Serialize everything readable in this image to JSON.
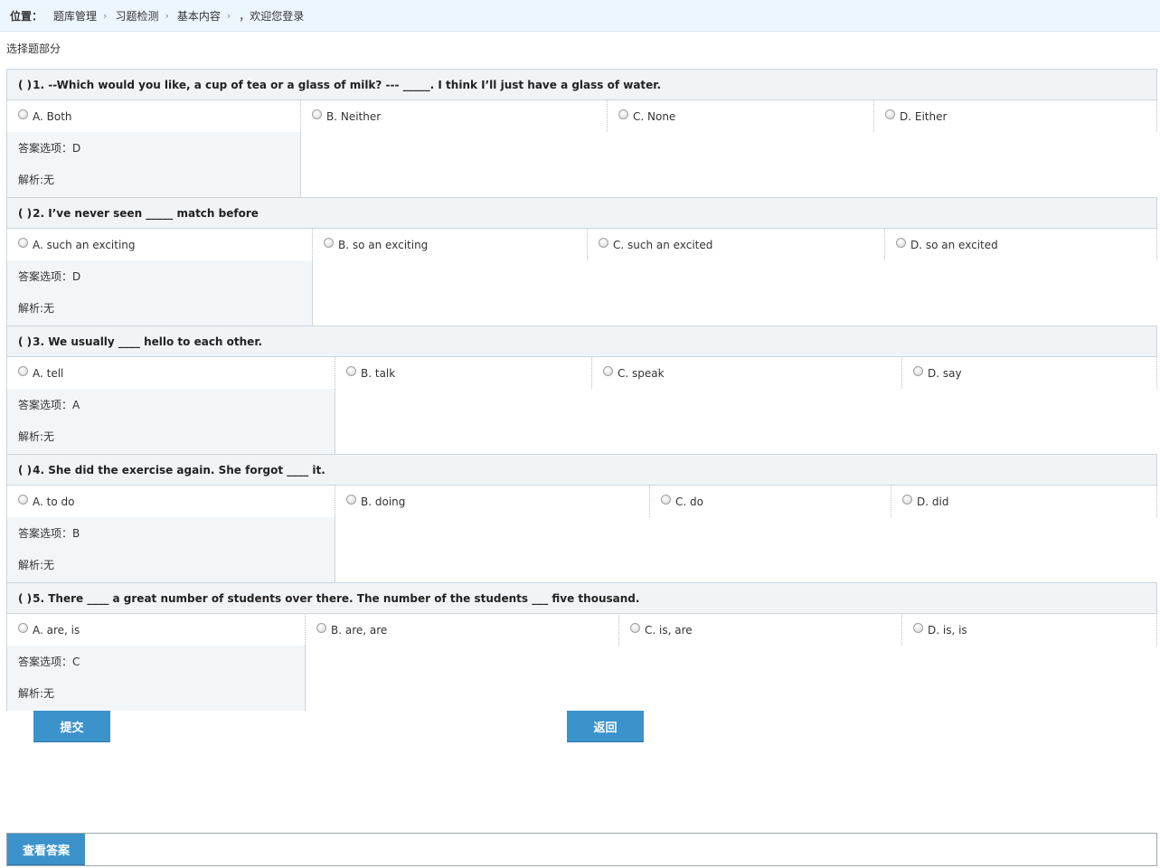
{
  "breadcrumb": {
    "label": "位置：",
    "items": [
      "题库管理",
      "习题检测",
      "基本内容"
    ],
    "welcome": "，欢迎您登录"
  },
  "section_title": "选择题部分",
  "questions": [
    {
      "title": "1. --Which would you like, a cup of tea or a glass of milk? --- _____. I think I’ll just have a glass of water.",
      "options": [
        "A. Both",
        "B. Neither",
        "C. None",
        "D. Either"
      ],
      "answer": "答案选项：D",
      "analysis": "解析:无"
    },
    {
      "title": "2. I’ve never seen _____ match before",
      "options": [
        "A. such an exciting",
        "B. so an exciting",
        "C. such an excited",
        "D. so an excited"
      ],
      "answer": "答案选项：D",
      "analysis": "解析:无"
    },
    {
      "title": "3. We usually ____ hello to each other.",
      "options": [
        "A. tell",
        "B. talk",
        "C. speak",
        "D. say"
      ],
      "answer": "答案选项：A",
      "analysis": "解析:无"
    },
    {
      "title": "4. She did the exercise again. She forgot ____ it.",
      "options": [
        "A. to do",
        "B. doing",
        "C. do",
        "D. did"
      ],
      "answer": "答案选项：B",
      "analysis": "解析:无"
    },
    {
      "title": "5. There ____ a great number of students over there. The number of the students ___ five thousand.",
      "options": [
        "A. are, is",
        "B. are, are",
        "C. is, are",
        "D. is, is"
      ],
      "answer": "答案选项：C",
      "analysis": "解析:无"
    }
  ],
  "buttons": {
    "submit": "提交",
    "back": "返回",
    "view_answer": "查看答案"
  },
  "colors": {
    "accent": "#3c93cc",
    "header_bg": "#eef6fd",
    "question_bg": "#f0f4f7"
  }
}
